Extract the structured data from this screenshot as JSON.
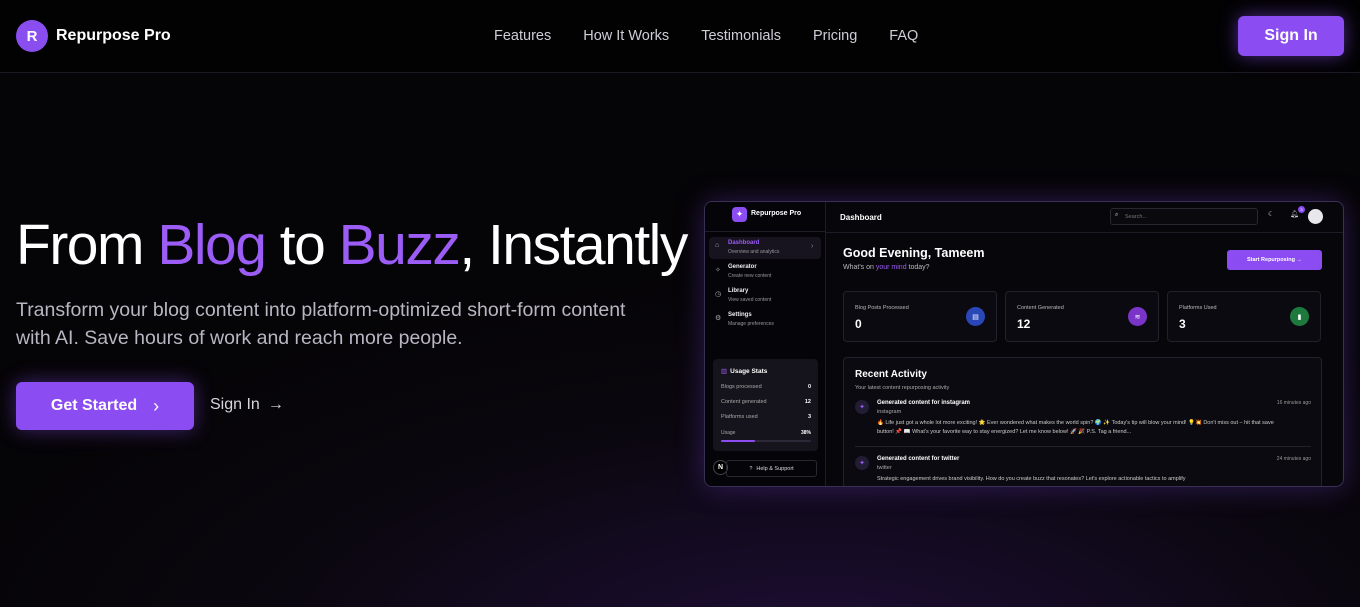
{
  "nav": {
    "logo_letter": "R",
    "brand": "Repurpose Pro",
    "links": [
      "Features",
      "How It Works",
      "Testimonials",
      "Pricing",
      "FAQ"
    ],
    "signin": "Sign In"
  },
  "hero": {
    "title_1": "From ",
    "title_2": "Blog",
    "title_3": " to ",
    "title_4": "Buzz",
    "title_5": ", Instantly",
    "subtitle": "Transform your blog content into platform-optimized short-form content with AI. Save hours of work and reach more people.",
    "cta_primary": "Get Started",
    "cta_secondary": "Sign In"
  },
  "preview": {
    "brand": "Repurpose Pro",
    "menu": [
      {
        "title": "Dashboard",
        "desc": "Overview and analytics",
        "icon": "home-icon"
      },
      {
        "title": "Generator",
        "desc": "Create new content",
        "icon": "sparkle-icon"
      },
      {
        "title": "Library",
        "desc": "View saved content",
        "icon": "clock-icon"
      },
      {
        "title": "Settings",
        "desc": "Manage preferences",
        "icon": "gear-icon"
      }
    ],
    "usage": {
      "title": "Usage Stats",
      "rows": [
        {
          "label": "Blogs processed",
          "value": "0"
        },
        {
          "label": "Content generated",
          "value": "12"
        },
        {
          "label": "Platforms used",
          "value": "3"
        }
      ],
      "usage_label": "Usage",
      "usage_value": "38%",
      "usage_fraction": 0.38
    },
    "help": "Help & Support",
    "avatar_letter": "N",
    "top_title": "Dashboard",
    "search_placeholder": "Search...",
    "notification_count": "3",
    "greeting": "Good Evening, Tameem",
    "greeting_sub_1": "What's on ",
    "greeting_sub_2": "your mind",
    "greeting_sub_3": " today?",
    "start_button": "Start Repurposing →",
    "cards": [
      {
        "label": "Blog Posts Processed",
        "value": "0",
        "color": "#2a47b8"
      },
      {
        "label": "Content Generated",
        "value": "12",
        "color": "#7a35c8"
      },
      {
        "label": "Platforms Used",
        "value": "3",
        "color": "#1e7a3c"
      }
    ],
    "activity": {
      "title": "Recent Activity",
      "subtitle": "Your latest content repurposing activity",
      "items": [
        {
          "head": "Generated content for instagram",
          "platform": "instagram",
          "time": "16 minutes ago",
          "text": "🔥 Life just got a whole lot more exciting! 🌟 Ever wondered what makes the world spin? 🌍 ✨ Today's tip will blow your mind! 💡💥 Don't miss out – hit that save button! 📌 📖 What's your favorite way to stay energized? Let me know below! 🚀 🎉 P.S. Tag a friend..."
        },
        {
          "head": "Generated content for twitter",
          "platform": "twitter",
          "time": "24 minutes ago",
          "text": "Strategic engagement drives brand visibility. How do you create buzz that resonates? Let's explore actionable tactics to amplify"
        }
      ]
    }
  },
  "colors": {
    "accent": "#8b4df2",
    "background": "#07060a"
  }
}
